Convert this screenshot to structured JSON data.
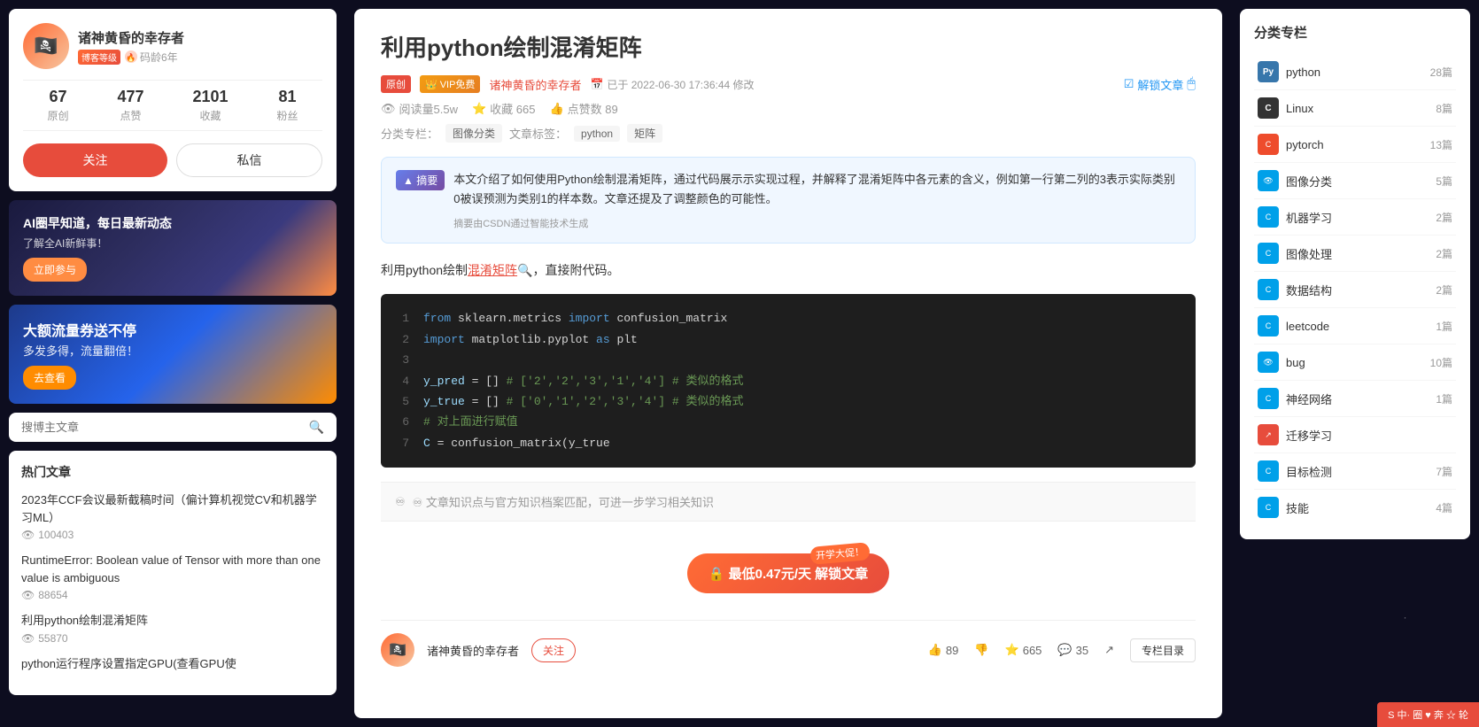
{
  "background": {
    "color": "#0d0d1f"
  },
  "left_sidebar": {
    "author": {
      "name": "诸神黄昏的幸存者",
      "avatar_emoji": "🏴‍☠️",
      "level_text": "博客等级",
      "duration": "码龄6年",
      "stats": [
        {
          "num": "67",
          "label": "原创"
        },
        {
          "num": "477",
          "label": "点赞"
        },
        {
          "num": "2101",
          "label": "收藏"
        },
        {
          "num": "81",
          "label": "粉丝"
        }
      ],
      "follow_btn": "关注",
      "message_btn": "私信"
    },
    "ad_ai": {
      "title": "AI圈早知道，每日最新动态",
      "subtitle": "了解全AI新鲜事！",
      "btn_label": "立即参与"
    },
    "ad_flow": {
      "title": "大额流量券送不停",
      "subtitle": "多发多得，流量翻倍！",
      "btn_label": "去查看"
    },
    "search": {
      "placeholder": "搜博主文章"
    },
    "hot_articles": {
      "title": "热门文章",
      "items": [
        {
          "title": "2023年CCF会议最新截稿时间（偏计算机视觉CV和机器学习ML）",
          "views": "100403"
        },
        {
          "title": "RuntimeError: Boolean value of Tensor with more than one value is ambiguous",
          "views": "88654"
        },
        {
          "title": "利用python绘制混淆矩阵",
          "views": "55870"
        },
        {
          "title": "python运行程序设置指定GPU(查看GPU使",
          "views": ""
        }
      ]
    }
  },
  "main": {
    "article_title": "利用python绘制混淆矩阵",
    "badges": {
      "original": "原创",
      "vip": "VIP免费"
    },
    "author_link": "诸神黄昏的幸存者",
    "date": "已于 2022-06-30 17:36:44 修改",
    "unlock_label": "解锁文章",
    "stats": {
      "views": "阅读量5.5w",
      "favorites": "收藏 665",
      "likes": "点赞数 89"
    },
    "tags_label": "分类专栏：",
    "category_tag": "图像分类",
    "article_label": "文章标签：",
    "tag1": "python",
    "tag2": "矩阵",
    "summary": {
      "icon": "▲ 摘要",
      "content": "本文介绍了如何使用Python绘制混淆矩阵，通过代码展示示实现过程，并解释了混淆矩阵中各元素的含义，例如第一行第二列的3表示实际类别0被误预测为类别1的样本数。文章还提及了调整颜色的可能性。",
      "footer": "摘要由CSDN通过智能技术生成"
    },
    "article_intro": "利用python绘制",
    "highlight_text": "混淆矩阵",
    "article_intro2": "，直接附代码。",
    "code": {
      "lines": [
        {
          "num": "1",
          "content": "from sklearn.metrics import confusion_matrix"
        },
        {
          "num": "2",
          "content": "import matplotlib.pyplot as plt"
        },
        {
          "num": "3",
          "content": ""
        },
        {
          "num": "4",
          "content": "y_pred = [] # ['2','2','3','1','4'] # 类似的格式"
        },
        {
          "num": "5",
          "content": "y_true = [] # ['0','1','2','3','4'] # 类似的格式"
        },
        {
          "num": "6",
          "content": "# 对上面进行赋值"
        },
        {
          "num": "7",
          "content": "C = confusion_matrix(y_true"
        }
      ]
    },
    "knowledge_bar": "♾ 文章知识点与官方知识档案匹配，可进一步学习相关知识",
    "paywall": {
      "promo": "开学大促！",
      "unlock_text": "🔒 最低0.47元/天 解锁文章"
    },
    "footer": {
      "author_name": "诸神黄昏的幸存者",
      "follow_btn": "关注",
      "likes_count": "89",
      "favorites_count": "665",
      "comments_count": "35",
      "catalog_btn": "专栏目录"
    }
  },
  "right_sidebar": {
    "title": "分类专栏",
    "categories": [
      {
        "name": "python",
        "count": "28篇",
        "type": "python"
      },
      {
        "name": "Linux",
        "count": "8篇",
        "type": "linux"
      },
      {
        "name": "pytorch",
        "count": "13篇",
        "type": "pytorch"
      },
      {
        "name": "图像分类",
        "count": "5篇",
        "type": "imgcls"
      },
      {
        "name": "机器学习",
        "count": "2篇",
        "type": "ml"
      },
      {
        "name": "图像处理",
        "count": "2篇",
        "type": "imgproc"
      },
      {
        "name": "数据结构",
        "count": "2篇",
        "type": "ds"
      },
      {
        "name": "leetcode",
        "count": "1篇",
        "type": "leetcode"
      },
      {
        "name": "bug",
        "count": "10篇",
        "type": "bug"
      },
      {
        "name": "神经网络",
        "count": "1篇",
        "type": "nn"
      },
      {
        "name": "迁移学习",
        "count": "",
        "type": "transfer"
      },
      {
        "name": "目标检测",
        "count": "7篇",
        "type": "objdet"
      },
      {
        "name": "技能",
        "count": "4篇",
        "type": "skill"
      }
    ]
  },
  "bottom_bar": {
    "label": "S 中· 圈 ♥ 奔 ☆ 轮"
  }
}
